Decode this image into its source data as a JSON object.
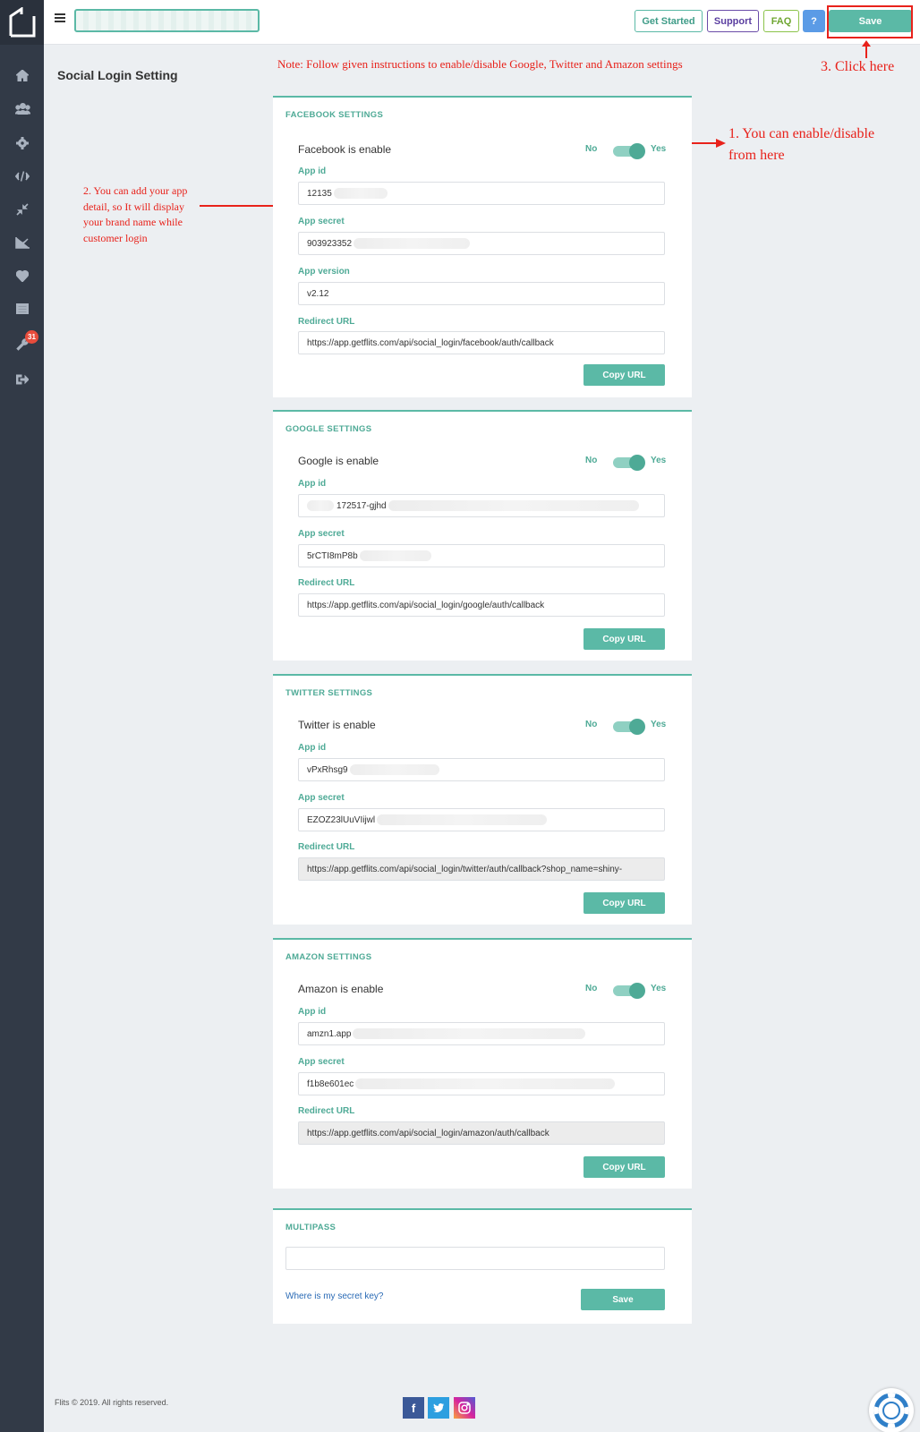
{
  "header": {
    "buttons": {
      "get_started": "Get Started",
      "support": "Support",
      "faq": "FAQ",
      "help": "?",
      "save": "Save"
    }
  },
  "page": {
    "title": "Social Login Setting",
    "note": "Note: Follow given instructions to enable/disable Google, Twitter and Amazon settings"
  },
  "sidebar": {
    "icons": [
      "home-icon",
      "users-icon",
      "gear-icon",
      "code-icon",
      "compress-icon",
      "chart-icon",
      "heart-icon",
      "list-icon",
      "wrench-icon",
      "logout-icon"
    ],
    "badge": "31"
  },
  "annotations": {
    "step1_line1": "1. You can enable/disable",
    "step1_line2": "from here",
    "step2_line1": "2. You can add your app",
    "step2_line2": "detail, so It will display",
    "step2_line3": "your brand name while",
    "step2_line4": "customer login",
    "step3": "3. Click here"
  },
  "common": {
    "no": "No",
    "yes": "Yes",
    "copy_url": "Copy URL",
    "app_id_label": "App id",
    "app_secret_label": "App secret",
    "app_version_label": "App version",
    "redirect_label": "Redirect URL"
  },
  "facebook": {
    "title": "FACEBOOK SETTINGS",
    "toggle_label": "Facebook is enable",
    "enabled": true,
    "app_id": "12135",
    "app_secret": "903923352",
    "app_version": "v2.12",
    "redirect_url": "https://app.getflits.com/api/social_login/facebook/auth/callback"
  },
  "google": {
    "title": "GOOGLE SETTINGS",
    "toggle_label": "Google is enable",
    "enabled": true,
    "app_id": "172517-gjhd",
    "app_secret": "5rCTI8mP8b",
    "redirect_url": "https://app.getflits.com/api/social_login/google/auth/callback"
  },
  "twitter": {
    "title": "TWITTER SETTINGS",
    "toggle_label": "Twitter is enable",
    "enabled": true,
    "app_id": "vPxRhsg9",
    "app_secret": "EZOZ23lUuVIijwl",
    "redirect_url": "https://app.getflits.com/api/social_login/twitter/auth/callback?shop_name=shiny-"
  },
  "amazon": {
    "title": "AMAZON SETTINGS",
    "toggle_label": "Amazon is enable",
    "enabled": true,
    "app_id": "amzn1.app",
    "app_secret": "f1b8e601ec",
    "redirect_url": "https://app.getflits.com/api/social_login/amazon/auth/callback"
  },
  "multipass": {
    "title": "MULTIPASS",
    "input_value": "",
    "link": "Where is my secret key?",
    "save": "Save"
  },
  "footer": {
    "copyright": "Flits © 2019. All rights reserved.",
    "social": [
      "facebook-icon",
      "twitter-icon",
      "instagram-icon"
    ]
  },
  "colors": {
    "accent": "#5bb9a6",
    "sidebar": "#323a47",
    "annotation": "#e8221b"
  }
}
